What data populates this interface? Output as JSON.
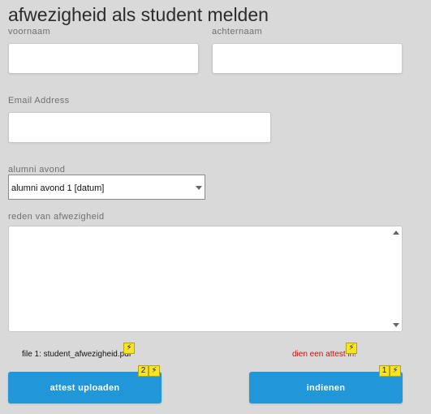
{
  "page": {
    "title": "afwezigheid als student melden"
  },
  "form": {
    "first_name": {
      "label": "voornaam",
      "value": ""
    },
    "last_name": {
      "label": "achternaam",
      "value": ""
    },
    "email": {
      "label": "Email Address",
      "value": ""
    },
    "alumni_evening": {
      "label": "alumni avond",
      "selected": "alumni avond 1 [datum]"
    },
    "reason": {
      "label": "reden van afwezigheid",
      "value": ""
    }
  },
  "attachments": {
    "file_label": "file 1: student_afwezigheid.pdf",
    "hint": "dien een attest in!"
  },
  "actions": {
    "upload_label": "attest uploaden",
    "submit_label": "indienen"
  },
  "annotations": {
    "upload_badge": "2",
    "submit_badge": "1",
    "bolt_glyph": "⚡"
  },
  "colors": {
    "background": "#d9d9d9",
    "button": "#2196d8",
    "hint": "#cc1111",
    "badge": "#f7e32a"
  }
}
